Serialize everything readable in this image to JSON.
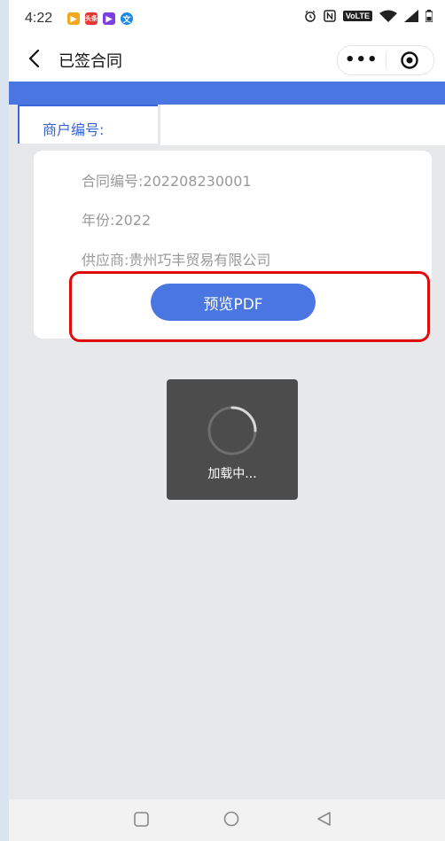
{
  "status_bar": {
    "time": "4:22",
    "app_icons": [
      "video-play-icon",
      "toutiao-news-icon",
      "video-play-icon",
      "translate-app-icon"
    ],
    "toutiao_text": "头条",
    "right_icons": [
      "alarm-icon",
      "nfc-icon",
      "volte-badge",
      "wifi-icon",
      "signal-icon",
      "battery-icon"
    ],
    "volte_label": "VoLTE"
  },
  "nav": {
    "title": "已签合同",
    "more_label": "•••"
  },
  "merchant": {
    "label": "商户编号:",
    "value": ""
  },
  "contract": {
    "number_label": "合同编号:",
    "number": "202208230001",
    "year_label": "年份:",
    "year": "2022",
    "supplier_label": "供应商:",
    "supplier": "贵州巧丰贸易有限公司",
    "preview_button": "预览PDF"
  },
  "toast": {
    "text": "加载中..."
  },
  "colors": {
    "primary": "#4a76e2",
    "highlight": "#e00c0c",
    "toast_bg": "#4c4c4c",
    "page_bg": "#e6e8ea"
  }
}
